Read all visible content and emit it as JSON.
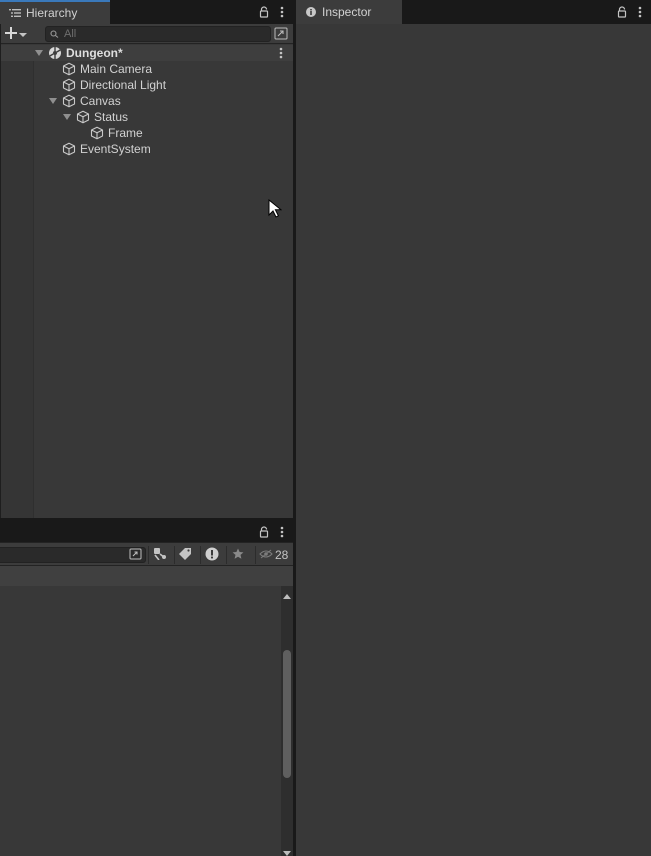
{
  "hierarchy": {
    "tab_label": "Hierarchy",
    "search_placeholder": "All",
    "scene": {
      "name": "Dungeon*"
    },
    "items": [
      {
        "label": "Main Camera"
      },
      {
        "label": "Directional Light"
      },
      {
        "label": "Canvas"
      },
      {
        "label": "Status"
      },
      {
        "label": "Frame"
      },
      {
        "label": "EventSystem"
      }
    ]
  },
  "inspector": {
    "tab_label": "Inspector"
  },
  "console": {
    "hidden_count": "28"
  },
  "icons": {
    "hierarchy_tab": "list-icon",
    "inspector_tab": "info-icon",
    "lock": "lock-icon",
    "menu": "kebab-menu-icon",
    "scene": "unity-scene-icon",
    "gameobject": "cube-icon",
    "search": "search-icon",
    "clear_on_play": "clear-icon",
    "collapse": "tag-icon",
    "error": "error-icon",
    "favorite": "star-icon",
    "visibility": "eye-icon"
  },
  "colors": {
    "panel_bg": "#383838",
    "tab_bg": "#3c3c3c",
    "frame_bg": "#191919",
    "active_tab_accent": "#3a79bb",
    "text": "#d2d2d2"
  }
}
